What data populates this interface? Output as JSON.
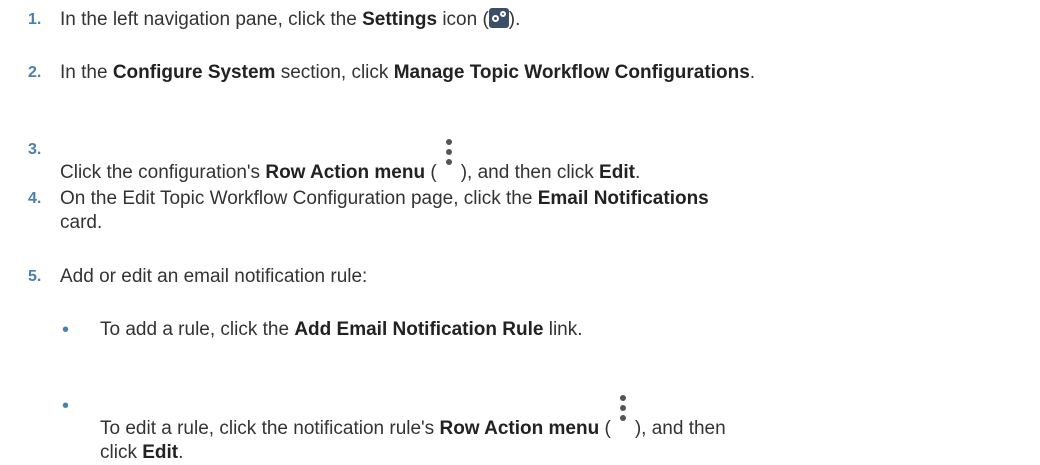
{
  "steps": [
    {
      "num": "1.",
      "a": "In the left navigation pane, click the ",
      "b": "Settings",
      "c": " icon (",
      "d": ")."
    },
    {
      "num": "2.",
      "a": "In the ",
      "b": "Configure System",
      "c": " section, click ",
      "d": "Manage Topic Workflow Configurations",
      "e": "."
    },
    {
      "num": "3.",
      "a": "Click the configuration's ",
      "b": "Row Action menu",
      "c": " (",
      "d": "), and then click ",
      "e": "Edit",
      "f": "."
    },
    {
      "num": "4.",
      "a": "On the Edit Topic Workflow Configuration page, click the ",
      "b": "Email Notifications",
      "c": "card."
    },
    {
      "num": "5.",
      "a": "Add or edit an email notification rule:"
    }
  ],
  "substeps": [
    {
      "bullet": "•",
      "a": "To add a rule, click the ",
      "b": "Add Email Notification Rule",
      "c": " link."
    },
    {
      "bullet": "•",
      "a": "To edit a rule, click the notification rule's ",
      "b": "Row Action menu",
      "c": " (",
      "d": "), and then",
      "e": "click ",
      "f": "Edit",
      "g": "."
    }
  ],
  "icons": {
    "settings": "settings-gear-icon",
    "row_action": "vertical-ellipsis-icon"
  }
}
